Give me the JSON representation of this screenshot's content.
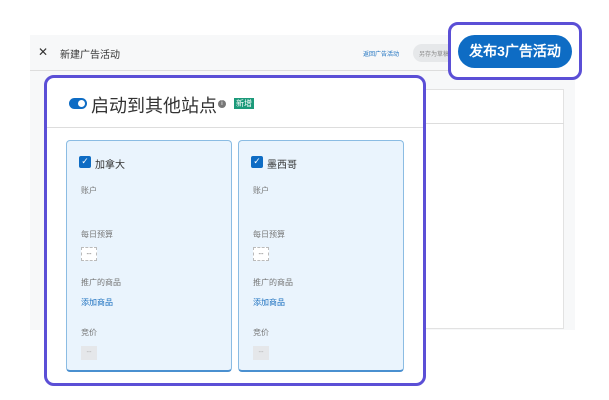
{
  "header": {
    "close_icon": "close-icon",
    "title": "新建广告活动",
    "back_link": "返回广告活动",
    "draft_button": "另存为草稿"
  },
  "publish_button": "发布3广告活动",
  "panel": {
    "title": "启动到其他站点",
    "toggle_on": true,
    "info_icon": "info-icon",
    "badge": "新增",
    "sites": [
      {
        "name": "加拿大",
        "checked": true,
        "account_label": "账户",
        "budget_label": "每日预算",
        "budget_value": "--",
        "products_label": "推广的商品",
        "add_products": "添加商品",
        "bid_label": "竞价",
        "bid_value": "--"
      },
      {
        "name": "墨西哥",
        "checked": true,
        "account_label": "账户",
        "budget_label": "每日预算",
        "budget_value": "--",
        "products_label": "推广的商品",
        "add_products": "添加商品",
        "bid_label": "竞价",
        "bid_value": "--"
      }
    ]
  },
  "colors": {
    "accent": "#0e6cc4",
    "highlight": "#5b4fd6",
    "badge": "#1c9a7a"
  }
}
